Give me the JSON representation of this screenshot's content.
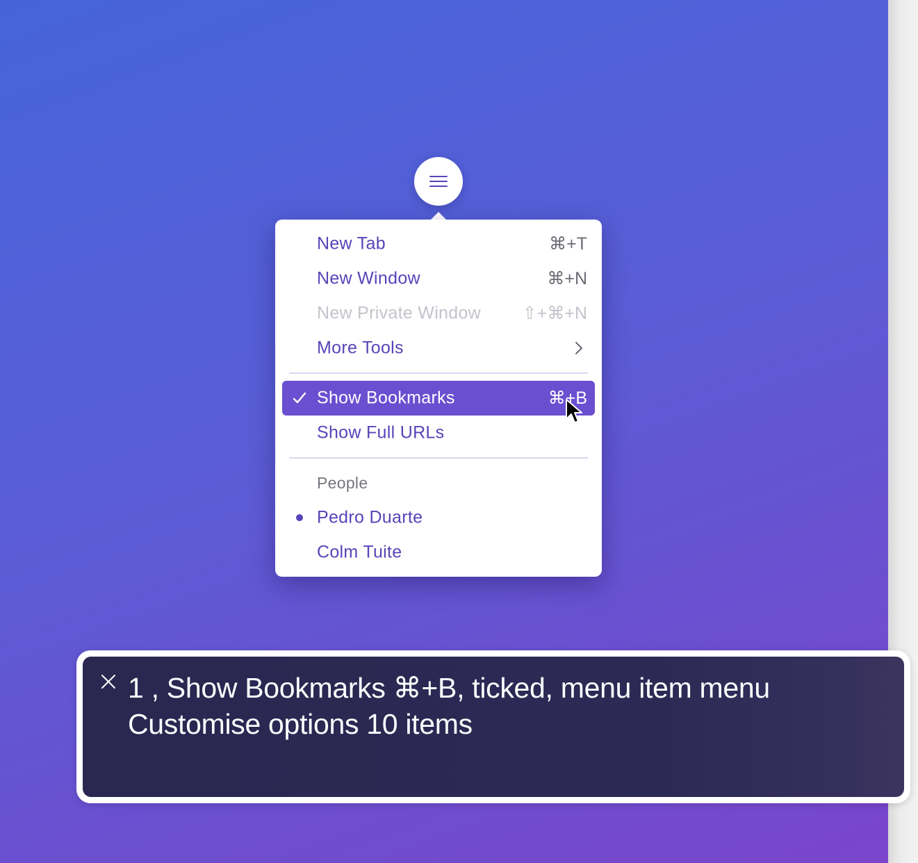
{
  "trigger": {
    "icon": "hamburger-icon"
  },
  "menu": {
    "items": [
      {
        "label": "New Tab",
        "shortcut": "⌘+T"
      },
      {
        "label": "New Window",
        "shortcut": "⌘+N"
      },
      {
        "label": "New Private Window",
        "shortcut": "⇧+⌘+N",
        "disabled": true
      },
      {
        "label": "More Tools",
        "submenu": true
      }
    ],
    "checkboxes": [
      {
        "label": "Show Bookmarks",
        "shortcut": "⌘+B",
        "checked": true,
        "highlighted": true
      },
      {
        "label": "Show Full URLs",
        "checked": false
      }
    ],
    "people": {
      "label": "People",
      "options": [
        {
          "label": "Pedro Duarte",
          "selected": true
        },
        {
          "label": "Colm Tuite",
          "selected": false
        }
      ]
    }
  },
  "announcement": {
    "line1": "1 , Show Bookmarks ⌘+B, ticked, menu item menu",
    "line2": "Customise options 10 items"
  },
  "colors": {
    "accent": "#6a4fd0",
    "item_text": "#5744b8",
    "background_start": "#4664da",
    "background_end": "#7a45cc"
  }
}
